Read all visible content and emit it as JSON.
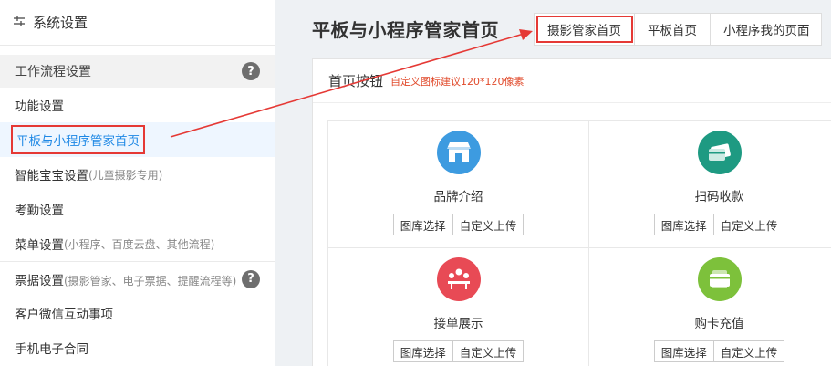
{
  "sidebar": {
    "header_icon": "settings-icon",
    "header_title": "系统设置",
    "group_title": "工作流程设置",
    "items": [
      {
        "label": "功能设置",
        "sub": ""
      },
      {
        "label": "平板与小程序管家首页",
        "sub": ""
      },
      {
        "label": "智能宝宝设置",
        "sub": "(儿童摄影专用)"
      },
      {
        "label": "考勤设置",
        "sub": ""
      },
      {
        "label": "菜单设置",
        "sub": "(小程序、百度云盘、其他流程)"
      },
      {
        "label": "票据设置",
        "sub": "(摄影管家、电子票据、提醒流程等)"
      },
      {
        "label": "客户微信互动事项",
        "sub": ""
      },
      {
        "label": "手机电子合同",
        "sub": ""
      }
    ],
    "help_mark": "?"
  },
  "main": {
    "title": "平板与小程序管家首页",
    "tabs": [
      "摄影管家首页",
      "平板首页",
      "小程序我的页面"
    ],
    "active_tab": "摄影管家首页",
    "panel_title": "首页按钮",
    "panel_hint": "自定义图标建议120*120像素",
    "cards": [
      {
        "label": "品牌介绍",
        "icon": "storefront-icon",
        "color": "#3d9be0"
      },
      {
        "label": "扫码收款",
        "icon": "card-payment-icon",
        "color": "#1e9a82"
      },
      {
        "label": "接单展示",
        "icon": "meeting-icon",
        "color": "#e84a55"
      },
      {
        "label": "购卡充值",
        "icon": "wallet-card-icon",
        "color": "#7dc13b"
      }
    ],
    "btn_gallery": "图库选择",
    "btn_upload": "自定义上传"
  },
  "colors": {
    "highlight": "#e53935",
    "active_blue": "#1e88e5"
  }
}
